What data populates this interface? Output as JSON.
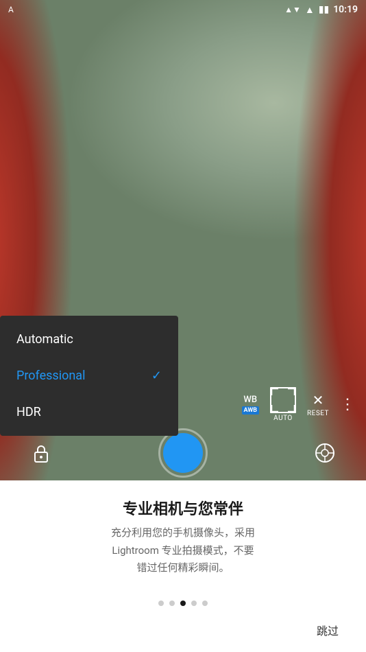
{
  "statusBar": {
    "time": "10:19",
    "batteryIcon": "🔋",
    "wifiIcon": "▼",
    "simIcon": "▲"
  },
  "camera": {
    "controls": {
      "wb": "WB",
      "wbBadge": "AWB",
      "auto": "AUTO",
      "reset": "RESET"
    }
  },
  "dropdown": {
    "items": [
      {
        "label": "Automatic",
        "selected": false
      },
      {
        "label": "Professional",
        "selected": true
      },
      {
        "label": "HDR",
        "selected": false
      }
    ]
  },
  "bottomSection": {
    "title": "专业相机与您常伴",
    "description": "充分利用您的手机摄像头，采用\nLightroom 专业拍摄模式，不要\n错过任何精彩瞬间。",
    "dots": [
      false,
      false,
      true,
      false,
      false
    ],
    "skipLabel": "跳过"
  }
}
